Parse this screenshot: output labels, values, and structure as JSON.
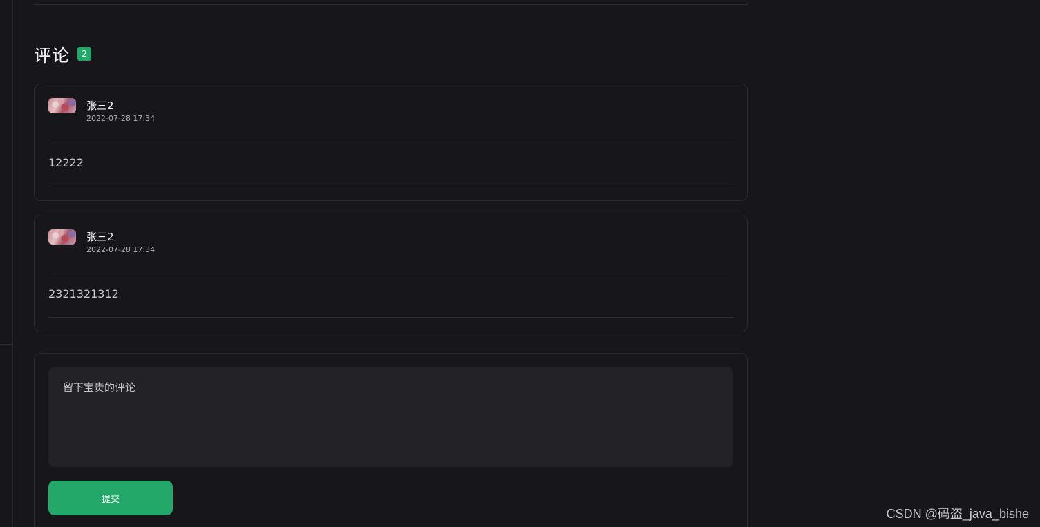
{
  "comments_section": {
    "title": "评论",
    "count": "2"
  },
  "comments": [
    {
      "author": "张三2",
      "time": "2022-07-28 17:34",
      "text": "12222"
    },
    {
      "author": "张三2",
      "time": "2022-07-28 17:34",
      "text": "2321321312"
    }
  ],
  "form": {
    "placeholder": "留下宝贵的评论",
    "submit_label": "提交"
  },
  "watermark": "CSDN @码盗_java_bishe",
  "colors": {
    "background": "#17161b",
    "accent_green": "#24a86a",
    "card_border": "#2a292f",
    "textarea_bg": "#232227"
  }
}
